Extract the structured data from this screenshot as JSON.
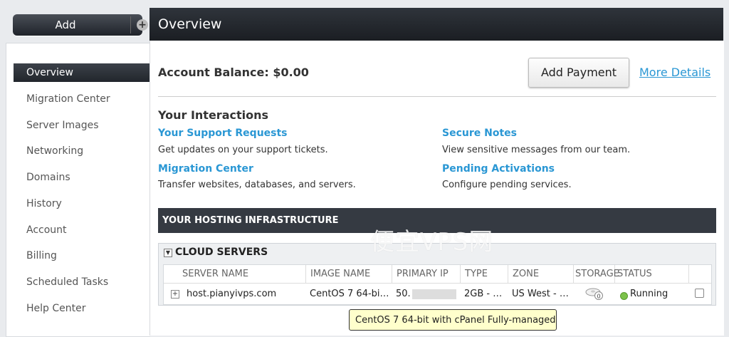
{
  "add_button": {
    "label": "Add",
    "plus": "+"
  },
  "sidebar": {
    "items": [
      {
        "label": "Overview",
        "active": true
      },
      {
        "label": "Migration Center"
      },
      {
        "label": "Server Images"
      },
      {
        "label": "Networking"
      },
      {
        "label": "Domains"
      },
      {
        "label": "History"
      },
      {
        "label": "Account"
      },
      {
        "label": "Billing"
      },
      {
        "label": "Scheduled Tasks"
      },
      {
        "label": "Help Center"
      }
    ]
  },
  "header": {
    "title": "Overview"
  },
  "account": {
    "balance_label": "Account Balance: $0.00",
    "add_payment": "Add Payment",
    "more_details": "More Details"
  },
  "interactions": {
    "title": "Your Interactions",
    "items": [
      {
        "title": "Your Support Requests",
        "desc": "Get updates on your support tickets."
      },
      {
        "title": "Secure Notes",
        "desc": "View sensitive messages from our team."
      },
      {
        "title": "Migration Center",
        "desc": "Transfer websites, databases, and servers."
      },
      {
        "title": "Pending Activations",
        "desc": "Configure pending services."
      }
    ]
  },
  "infrastructure": {
    "title": "YOUR HOSTING INFRASTRUCTURE",
    "cloud_title": "CLOUD SERVERS",
    "columns": [
      "SERVER NAME",
      "IMAGE NAME",
      "PRIMARY IP",
      "TYPE",
      "ZONE",
      "STORAGE",
      "STATUS"
    ],
    "row": {
      "server_name": "host.pianyivps.com",
      "image_name": "CentOS 7 64-bi…",
      "primary_ip": "50.",
      "type": "2GB - …",
      "zone": "US West - …",
      "status": "Running"
    }
  },
  "tooltip": "CentOS 7 64-bit with cPanel Fully-managed",
  "watermark": "便宜VPS网",
  "colors": {
    "accent": "#2a97d4",
    "dark_bar": "#353a42",
    "status_ok": "#7cc24a"
  }
}
